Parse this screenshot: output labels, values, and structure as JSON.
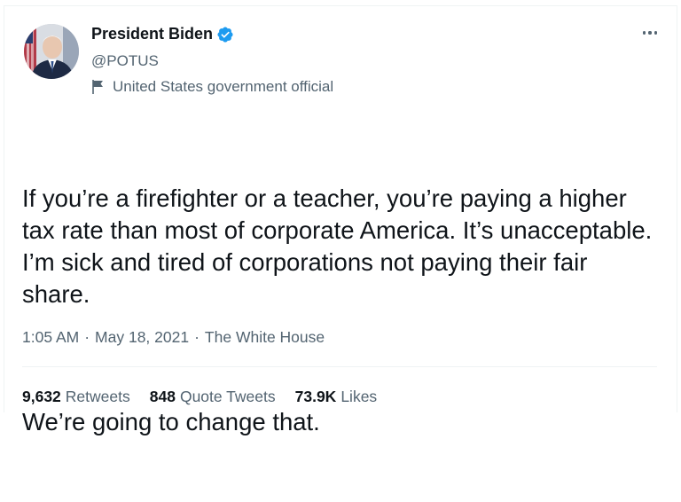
{
  "tweet": {
    "author_name": "President Biden",
    "handle": "@POTUS",
    "label": "United States government official",
    "text_paragraphs": [
      "If you’re a firefighter or a teacher, you’re paying a higher tax rate than most of corporate America. It’s unacceptable. I’m sick and tired of corporations not paying their fair share.",
      "We’re going to change that."
    ],
    "time": "1:05 AM",
    "date": "May 18, 2021",
    "source": "The White House",
    "separator": "·"
  },
  "stats": {
    "retweets_count": "9,632",
    "retweets_label": "Retweets",
    "quotes_count": "848",
    "quotes_label": "Quote Tweets",
    "likes_count": "73.9K",
    "likes_label": "Likes"
  },
  "icons": {
    "verified": "verified-badge-icon",
    "label_flag": "flag-icon",
    "more": "more-options-icon"
  },
  "colors": {
    "verified_blue": "#1d9bf0",
    "secondary_text": "#536471",
    "primary_text": "#0f1419"
  }
}
